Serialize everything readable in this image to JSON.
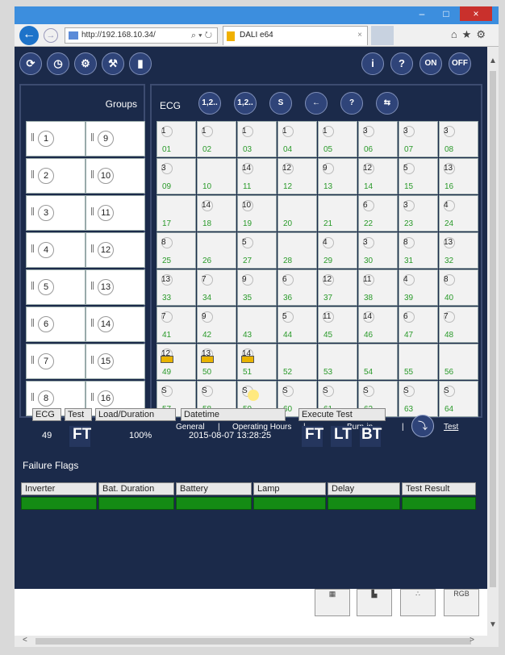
{
  "browser": {
    "url": "http://192.168.10.34/",
    "search_icon": "search-icon",
    "tab_title": "DALI e64",
    "tab_close": "×",
    "min_label": "–",
    "max_label": "□",
    "close_label": "×",
    "tools_label": "⌕ ▾ ↻"
  },
  "toolbar": {
    "right": {
      "info": "i",
      "lamp": "💡",
      "on": "ON",
      "off": "OFF"
    }
  },
  "groups": {
    "title": "Groups",
    "left": [
      "1",
      "2",
      "3",
      "4",
      "5",
      "6",
      "7",
      "8"
    ],
    "right": [
      "9",
      "10",
      "11",
      "12",
      "13",
      "14",
      "15",
      "16"
    ]
  },
  "ecg": {
    "title": "ECG",
    "buttons": [
      "1,2..",
      "1,2..",
      "S",
      "←",
      "?",
      "⇆"
    ],
    "cells": [
      {
        "n": "01",
        "m": "1"
      },
      {
        "n": "02",
        "m": "1"
      },
      {
        "n": "03",
        "m": "1"
      },
      {
        "n": "04",
        "m": "1"
      },
      {
        "n": "05",
        "m": "1"
      },
      {
        "n": "06",
        "m": "3"
      },
      {
        "n": "07",
        "m": "3"
      },
      {
        "n": "08",
        "m": "3"
      },
      {
        "n": "09",
        "m": "3"
      },
      {
        "n": "10",
        "m": ""
      },
      {
        "n": "11",
        "m": "14"
      },
      {
        "n": "12",
        "m": "12"
      },
      {
        "n": "13",
        "m": "9"
      },
      {
        "n": "14",
        "m": "12"
      },
      {
        "n": "15",
        "m": "5"
      },
      {
        "n": "16",
        "m": "13"
      },
      {
        "n": "17",
        "m": ""
      },
      {
        "n": "18",
        "m": "14"
      },
      {
        "n": "19",
        "m": "10"
      },
      {
        "n": "20",
        "m": ""
      },
      {
        "n": "21",
        "m": ""
      },
      {
        "n": "22",
        "m": "6"
      },
      {
        "n": "23",
        "m": "3"
      },
      {
        "n": "24",
        "m": "4"
      },
      {
        "n": "25",
        "m": "8"
      },
      {
        "n": "26",
        "m": ""
      },
      {
        "n": "27",
        "m": "5"
      },
      {
        "n": "28",
        "m": ""
      },
      {
        "n": "29",
        "m": "4"
      },
      {
        "n": "30",
        "m": "3"
      },
      {
        "n": "31",
        "m": "8"
      },
      {
        "n": "32",
        "m": "13"
      },
      {
        "n": "33",
        "m": "13"
      },
      {
        "n": "34",
        "m": "7"
      },
      {
        "n": "35",
        "m": "9"
      },
      {
        "n": "36",
        "m": "6"
      },
      {
        "n": "37",
        "m": "12"
      },
      {
        "n": "38",
        "m": "11"
      },
      {
        "n": "39",
        "m": "4"
      },
      {
        "n": "40",
        "m": "8"
      },
      {
        "n": "41",
        "m": "7"
      },
      {
        "n": "42",
        "m": "9"
      },
      {
        "n": "43",
        "m": ""
      },
      {
        "n": "44",
        "m": "5"
      },
      {
        "n": "45",
        "m": "11"
      },
      {
        "n": "46",
        "m": "14"
      },
      {
        "n": "47",
        "m": "6"
      },
      {
        "n": "48",
        "m": "7"
      },
      {
        "n": "49",
        "m": "12",
        "battery": true
      },
      {
        "n": "50",
        "m": "13",
        "battery": true
      },
      {
        "n": "51",
        "m": "14",
        "battery": true
      },
      {
        "n": "52",
        "m": ""
      },
      {
        "n": "53",
        "m": ""
      },
      {
        "n": "54",
        "m": ""
      },
      {
        "n": "55",
        "m": ""
      },
      {
        "n": "56",
        "m": ""
      },
      {
        "n": "57",
        "m": "S"
      },
      {
        "n": "58",
        "m": "S"
      },
      {
        "n": "59",
        "m": "S",
        "hover": true
      },
      {
        "n": "60",
        "m": "S"
      },
      {
        "n": "61",
        "m": "S"
      },
      {
        "n": "62",
        "m": "S"
      },
      {
        "n": "63",
        "m": "S"
      },
      {
        "n": "64",
        "m": "S"
      }
    ]
  },
  "tabs": {
    "general": "General",
    "sep1": "|",
    "operating_hours": "Operating Hours",
    "sep2": "|",
    "burn_in": "Burn-in",
    "sep3": "|",
    "test": "Test"
  },
  "info": {
    "headers": {
      "ecg": "ECG",
      "test": "Test",
      "load": "Load/Duration",
      "datetime": "Datetime",
      "execute": "Execute Test"
    },
    "values": {
      "ecg": "49",
      "test": "FT",
      "load": "100%",
      "datetime": "2015-08-07 13:28:25"
    },
    "execute_buttons": [
      "FT",
      "LT",
      "BT"
    ],
    "failure_title": "Failure Flags",
    "failure_headers": [
      "Inverter",
      "Bat. Duration",
      "Battery",
      "Lamp",
      "Delay",
      "Test Result"
    ]
  },
  "bottom_nav": {
    "rgb_label": "RGB"
  },
  "colors": {
    "app_bg": "#1b2a4a",
    "cell_number": "#2a9a2a",
    "flag_ok": "#148b14",
    "battery": "#e8b300"
  }
}
